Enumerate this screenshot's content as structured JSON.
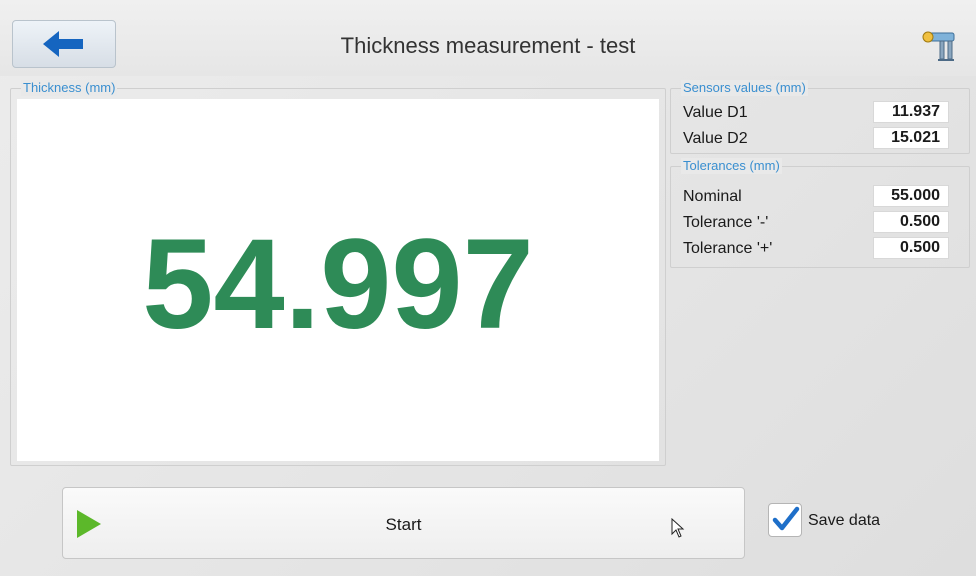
{
  "header": {
    "title": "Thickness measurement - test",
    "back_icon": "arrow-left-icon",
    "tool_icon": "caliper-icon"
  },
  "thickness": {
    "legend": "Thickness (mm)",
    "value": "54.997",
    "color": "#2e8b57"
  },
  "sensors": {
    "legend": "Sensors values (mm)",
    "rows": [
      {
        "label": "Value D1",
        "value": "11.937"
      },
      {
        "label": "Value D2",
        "value": "15.021"
      }
    ]
  },
  "tolerances": {
    "legend": "Tolerances (mm)",
    "rows": [
      {
        "label": "Nominal",
        "value": "55.000"
      },
      {
        "label": "Tolerance '-'",
        "value": "0.500"
      },
      {
        "label": "Tolerance '+'",
        "value": "0.500"
      }
    ]
  },
  "actions": {
    "start_label": "Start",
    "start_icon": "play-icon",
    "save_label": "Save data",
    "save_checked": true
  },
  "colors": {
    "accent_blue": "#1565c0",
    "legend_blue": "#3a8fd0",
    "play_green": "#5cb82a"
  }
}
